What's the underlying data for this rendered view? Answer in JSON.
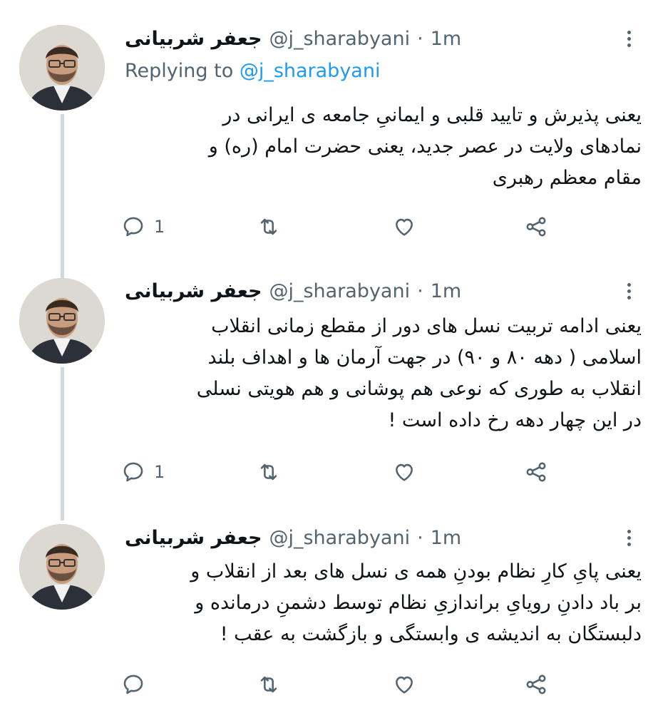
{
  "tweets": [
    {
      "name": "جعفر شربیانی",
      "handle": "@j_sharabyani",
      "separator": "·",
      "time": "1m",
      "replying_prefix": "Replying to",
      "replying_handle": "@j_sharabyani",
      "lines": [
        "یعنی پذیرش و تایید قلبی و ایمانیِ جامعه ی ایرانی در",
        "نمادهای ولایت در عصر جدید، یعنی حضرت امام (ره) و",
        "مقام معظم رهبری"
      ],
      "reply_count": "1",
      "icons": [
        "reply-icon",
        "retweet-icon",
        "like-icon",
        "share-icon"
      ]
    },
    {
      "name": "جعفر شربیانی",
      "handle": "@j_sharabyani",
      "separator": "·",
      "time": "1m",
      "lines": [
        "یعنی ادامه تربیت نسل های دور از مقطع زمانی انقلاب",
        "اسلامی ( دهه ۸۰ و ۹۰) در جهت آرمان ها و اهداف بلند",
        "انقلاب به طوری که نوعی هم پوشانی و هم هویتی نسلی",
        "در این چهار دهه رخ داده است !"
      ],
      "reply_count": "1",
      "icons": [
        "reply-icon",
        "retweet-icon",
        "like-icon",
        "share-icon"
      ]
    },
    {
      "name": "جعفر شربیانی",
      "handle": "@j_sharabyani",
      "separator": "·",
      "time": "1m",
      "lines": [
        "یعنی پایِ کارِ نظام بودنِ همه ی نسل های بعد از انقلاب و",
        "بر باد دادنِ رویایِ براندازیِ نظام توسط دشمنِ درمانده و",
        "دلبستگان به اندیشه ی وابستگی و بازگشت به عقب !"
      ],
      "reply_count": "",
      "icons": [
        "reply-icon",
        "retweet-icon",
        "like-icon",
        "share-icon"
      ]
    }
  ],
  "colors": {
    "text": "#0f1419",
    "secondary": "#536471",
    "link": "#1d9bf0",
    "thread_line": "#cfd9de"
  }
}
